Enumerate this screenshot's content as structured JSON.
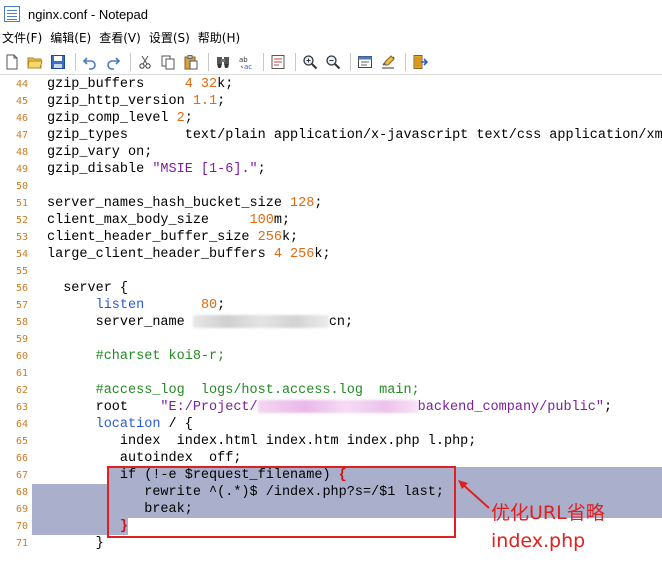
{
  "window": {
    "title": "nginx.conf - Notepad"
  },
  "menu": [
    "文件(F)",
    "编辑(E)",
    "查看(V)",
    "设置(S)",
    "帮助(H)"
  ],
  "toolbar": [
    "new-file-icon",
    "open-folder-icon",
    "save-icon",
    "separator",
    "undo-icon",
    "redo-icon",
    "separator",
    "cut-icon",
    "copy-icon",
    "paste-icon",
    "separator",
    "find-icon",
    "replace-icon",
    "separator",
    "word-wrap-icon",
    "separator",
    "zoom-in-icon",
    "zoom-out-icon",
    "separator",
    "settings-icon",
    "edit-check-icon",
    "separator",
    "exit-icon"
  ],
  "lines": [
    {
      "n": "44",
      "t": [
        [
          "gzip_buffers     ",
          ""
        ],
        [
          "4 32",
          "num"
        ],
        [
          "k;",
          ""
        ]
      ]
    },
    {
      "n": "45",
      "t": [
        [
          "gzip_http_version ",
          ""
        ],
        [
          "1.1",
          "num"
        ],
        [
          ";",
          ""
        ]
      ]
    },
    {
      "n": "46",
      "t": [
        [
          "gzip_comp_level ",
          ""
        ],
        [
          "2",
          "num"
        ],
        [
          ";",
          ""
        ]
      ]
    },
    {
      "n": "47",
      "t": [
        [
          "gzip_types       text/plain application/x-javascript text/css application/xml;",
          ""
        ]
      ]
    },
    {
      "n": "48",
      "t": [
        [
          "gzip_vary on;",
          ""
        ]
      ]
    },
    {
      "n": "49",
      "t": [
        [
          "gzip_disable ",
          ""
        ],
        [
          "\"MSIE [1-6].\"",
          "str"
        ],
        [
          ";",
          ""
        ]
      ]
    },
    {
      "n": "50",
      "t": []
    },
    {
      "n": "51",
      "t": [
        [
          "server_names_hash_bucket_size ",
          ""
        ],
        [
          "128",
          "num"
        ],
        [
          ";",
          ""
        ]
      ]
    },
    {
      "n": "52",
      "t": [
        [
          "client_max_body_size     ",
          ""
        ],
        [
          "100",
          "num"
        ],
        [
          "m;",
          ""
        ]
      ]
    },
    {
      "n": "53",
      "t": [
        [
          "client_header_buffer_size ",
          ""
        ],
        [
          "256",
          "num"
        ],
        [
          "k;",
          ""
        ]
      ]
    },
    {
      "n": "54",
      "t": [
        [
          "large_client_header_buffers ",
          ""
        ],
        [
          "4 256",
          "num"
        ],
        [
          "k;",
          ""
        ]
      ]
    },
    {
      "n": "55",
      "t": []
    },
    {
      "n": "56",
      "t": [
        [
          "  server {",
          ""
        ]
      ]
    },
    {
      "n": "57",
      "t": [
        [
          "      ",
          ""
        ],
        [
          "listen",
          "kw"
        ],
        [
          "       ",
          ""
        ],
        [
          "80",
          "num"
        ],
        [
          ";",
          ""
        ]
      ]
    },
    {
      "n": "58",
      "t": [
        [
          "      server_name ",
          ""
        ],
        [
          "",
          "blur"
        ],
        [
          "cn;",
          ""
        ]
      ]
    },
    {
      "n": "59",
      "t": []
    },
    {
      "n": "60",
      "t": [
        [
          "      ",
          ""
        ],
        [
          "#charset koi8-r;",
          "cmt"
        ]
      ]
    },
    {
      "n": "61",
      "t": []
    },
    {
      "n": "62",
      "t": [
        [
          "      ",
          ""
        ],
        [
          "#access_log  logs/host.access.log  main;",
          "cmt"
        ]
      ]
    },
    {
      "n": "63",
      "t": [
        [
          "      root    ",
          ""
        ],
        [
          "\"E:/Project/",
          "str"
        ],
        [
          "",
          "blur-pink"
        ],
        [
          "backend_company/public\"",
          "str"
        ],
        [
          ";",
          ""
        ]
      ]
    },
    {
      "n": "64",
      "t": [
        [
          "      ",
          ""
        ],
        [
          "location",
          "kw"
        ],
        [
          " / {",
          ""
        ]
      ]
    },
    {
      "n": "65",
      "t": [
        [
          "         index  index.html index.htm index.php l.php;",
          ""
        ]
      ]
    },
    {
      "n": "66",
      "t": [
        [
          "         autoindex  off;",
          ""
        ]
      ]
    },
    {
      "n": "67",
      "t": [
        [
          "         if (!-e $request_filename) ",
          ""
        ],
        [
          "{",
          "brace"
        ]
      ]
    },
    {
      "n": "68",
      "t": [
        [
          "            rewrite ^(.*)$ /index.php?s=/$1 last;",
          ""
        ]
      ]
    },
    {
      "n": "69",
      "t": [
        [
          "            break;",
          ""
        ]
      ]
    },
    {
      "n": "70",
      "t": [
        [
          "         ",
          ""
        ],
        [
          "}",
          "brace"
        ]
      ]
    },
    {
      "n": "71",
      "t": [
        [
          "      }",
          ""
        ]
      ]
    }
  ],
  "annotation": {
    "text": "优化URL省略\nindex.php"
  },
  "colors": {
    "selection": "#aab0cc",
    "annotation_red": "#e02020",
    "line_number": "#d07a20",
    "keyword": "#2a5bd7",
    "number": "#e06a10",
    "string": "#7a1fa0",
    "comment": "#228b22"
  }
}
